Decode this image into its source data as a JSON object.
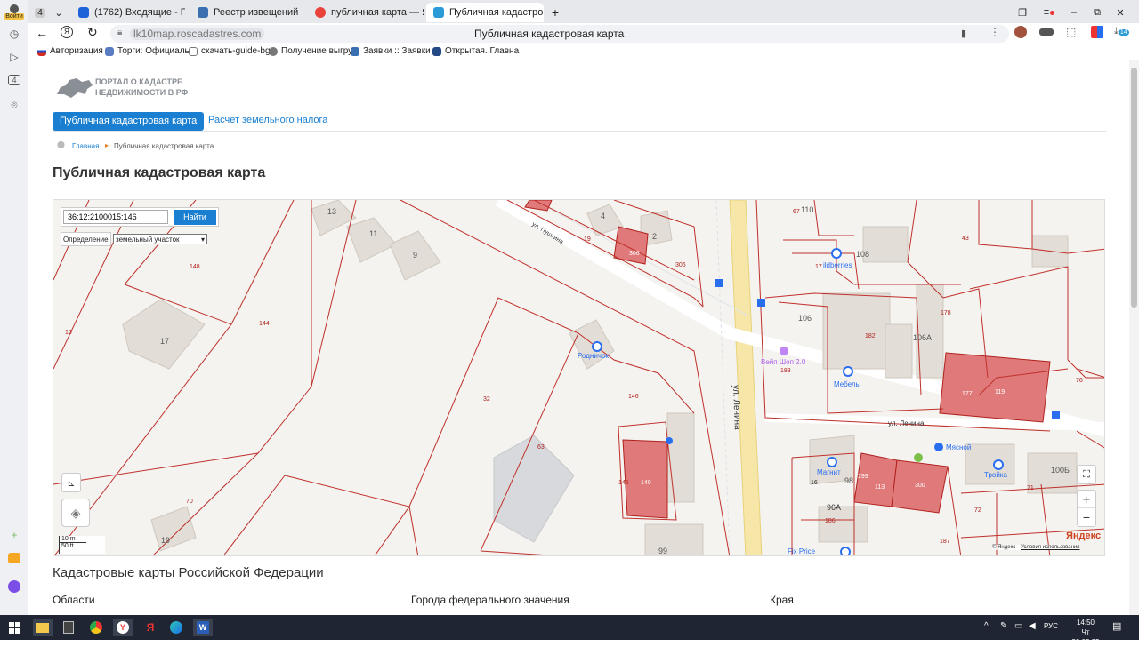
{
  "browser": {
    "profile_label": "Войти",
    "tab_count_badge": "4",
    "tabs": [
      {
        "title": "(1762) Входящие - Почта",
        "fav_color": "#1e63d8"
      },
      {
        "title": "Реестр извещений",
        "fav_color": "#3a6fb0"
      },
      {
        "title": "публичная карта — Янде",
        "fav_color": "#e8423a"
      },
      {
        "title": "Публичная кадастровая",
        "fav_color": "#2a9bd6"
      }
    ],
    "address": "lk10map.roscadastres.com",
    "page_title": "Публичная кадастровая карта",
    "bookmarks": [
      "Авторизация",
      "Торги: Официаль",
      "скачать-guide-bg",
      "Получение выгру",
      "Заявки :: Заявки",
      "Открытая. Главна"
    ],
    "extension_badge": "14"
  },
  "site": {
    "logo_line1": "ПОРТАЛ О КАДАСТРЕ",
    "logo_line2": "НЕДВИЖИМОСТИ В РФ",
    "nav_active": "Публичная кадастровая карта",
    "nav_other": "Расчет земельного налога",
    "breadcrumb_home": "Главная",
    "breadcrumb_current": "Публичная кадастровая карта",
    "h1": "Публичная кадастровая карта",
    "section_title": "Кадастровые карты Российской Федерации",
    "columns": [
      "Области",
      "Города федерального значения",
      "Края"
    ]
  },
  "map": {
    "search_value": "36:12:2100015:146",
    "search_button": "Найти",
    "definition_label": "Определение",
    "definition_value": "земельный участок",
    "scale_metric": "10 m",
    "scale_imperial": "50 ft",
    "zoom_in": "+",
    "zoom_out": "−",
    "copyright": "© Яндекс",
    "terms": "Условия использования",
    "brand": "Яндекс",
    "streets": [
      "ул. Ленина",
      "ул. Ленина",
      "ул. Пушкина"
    ],
    "pois": [
      "Родничок",
      "Вейп Шоп 2.0",
      "Мебель",
      "ildberries",
      "Мясной",
      "Магнит",
      "Тройка",
      "Fix Price"
    ],
    "parcel_labels": [
      "148",
      "144",
      "10",
      "70",
      "32",
      "63",
      "146",
      "145",
      "140",
      "306",
      "306",
      "19",
      "182",
      "178",
      "177",
      "119",
      "183",
      "76",
      "299",
      "113",
      "300",
      "186",
      "72",
      "71",
      "187",
      "96А",
      "16",
      "98",
      "67",
      "43",
      "17"
    ],
    "building_labels": [
      "13",
      "11",
      "9",
      "4",
      "17",
      "19",
      "2",
      "110",
      "108",
      "106",
      "106А",
      "100Б",
      "99"
    ]
  },
  "taskbar": {
    "lang": "РУС",
    "time": "14:50",
    "date": "Чт 29.05.25"
  }
}
